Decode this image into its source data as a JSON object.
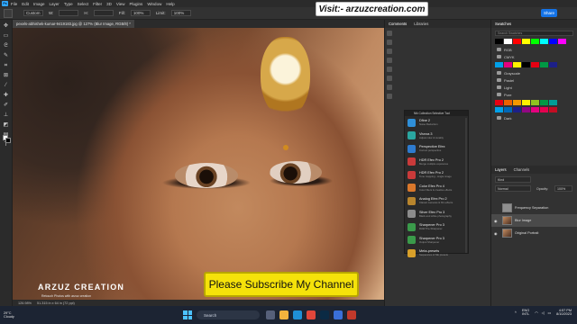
{
  "menubar": {
    "app_logo": "Ps",
    "items": [
      "File",
      "Edit",
      "Image",
      "Layer",
      "Type",
      "Select",
      "Filter",
      "3D",
      "View",
      "Plugins",
      "Window",
      "Help"
    ]
  },
  "options": {
    "mode_label": "Custom",
    "w_label": "W:",
    "h_label": "H:",
    "fill_label": "Fill:",
    "fill_value": "100%",
    "limit_label": "Limit:",
    "limit_value": "100%",
    "share_label": "Share"
  },
  "banner": {
    "text": "Visit:- arzuzcreation.com"
  },
  "document": {
    "tab_title": "pexels-abhishek-kumar-9419183.jpg @ 127% (Blur Image, RGB/8) *",
    "status_zoom": "126.98%",
    "status_info": "51.315 in x 64 in (72 ppi)"
  },
  "overlay": {
    "brand": "ARZUZ CREATION",
    "brand_sub": "Retouch Photos with arzuz creation",
    "subscribe": "Please Subscribe My Channel"
  },
  "midpanel": {
    "tabs": [
      "Comments",
      "Libraries"
    ]
  },
  "plugin": {
    "title": "Nik Collection Selective Tool",
    "items": [
      {
        "name": "Dfine 2",
        "desc": "Noise Reduction",
        "color": "#2f8fd8"
      },
      {
        "name": "Viveza 3",
        "desc": "Adjust color & tonality",
        "color": "#2aa6a0"
      },
      {
        "name": "Perspective Efex",
        "desc": "Correct perspective",
        "color": "#2e7bcf"
      },
      {
        "name": "HDR Efex Pro 2",
        "desc": "Merge multiple exposures",
        "color": "#c93a3a"
      },
      {
        "name": "HDR Efex Pro 2",
        "desc": "Tone mapping - single image",
        "color": "#c93a3a"
      },
      {
        "name": "Color Efex Pro 4",
        "desc": "Color filters & creative effects",
        "color": "#d9772b"
      },
      {
        "name": "Analog Efex Pro 2",
        "desc": "Classic cameras & film effects",
        "color": "#b8852d"
      },
      {
        "name": "Silver Efex Pro 3",
        "desc": "Black and white photography",
        "color": "#8c8c8c"
      },
      {
        "name": "Sharpener Pro 3",
        "desc": "RAW Pre-Sharpener",
        "color": "#3a9a4a"
      },
      {
        "name": "Sharpener Pro 3",
        "desc": "Output Sharpener",
        "color": "#3a9a4a"
      },
      {
        "name": "Meta-presets",
        "desc": "Sequences of Nik presets",
        "color": "#d8a02a"
      }
    ]
  },
  "swatches": {
    "title": "Swatches",
    "search_placeholder": "Search Swatches",
    "top_row": [
      "#000000",
      "#ffffff",
      "#ff0000",
      "#ffff00",
      "#00ff00",
      "#00ffff",
      "#0000ff",
      "#ff00ff"
    ],
    "folders": [
      {
        "name": "RGB",
        "colors": []
      },
      {
        "name": "CMYK",
        "colors": [
          "#00a0e9",
          "#e4007f",
          "#fff100",
          "#000000",
          "#e60012",
          "#009944",
          "#1d2088"
        ]
      },
      {
        "name": "Grayscale",
        "colors": []
      },
      {
        "name": "Pastel",
        "colors": []
      },
      {
        "name": "Light",
        "colors": []
      },
      {
        "name": "Pure",
        "colors": [
          "#e60012",
          "#eb6100",
          "#f39800",
          "#fff100",
          "#8fc31f",
          "#009944",
          "#009e96",
          "#00a0e9",
          "#0068b7",
          "#1d2088",
          "#920783",
          "#e4007f",
          "#e5004f",
          "#c30d23"
        ]
      },
      {
        "name": "Dark",
        "colors": []
      }
    ]
  },
  "layers": {
    "tabs": [
      "Layers",
      "Channels"
    ],
    "kind_label": "Kind",
    "blend_mode": "Normal",
    "opacity_label": "Opacity:",
    "opacity_value": "100%",
    "items": [
      {
        "name": "Frequency Separation",
        "type": "group"
      },
      {
        "name": "Blur Image",
        "type": "image",
        "selected": true
      },
      {
        "name": "Original Portrait",
        "type": "image",
        "selected": false
      }
    ]
  },
  "taskbar": {
    "weather_temp": "29°C",
    "weather_desc": "Cloudy",
    "search_placeholder": "Search",
    "lang": "ENG",
    "lang2": "INTL",
    "time": "4:57 PM",
    "date": "8/10/2023"
  }
}
